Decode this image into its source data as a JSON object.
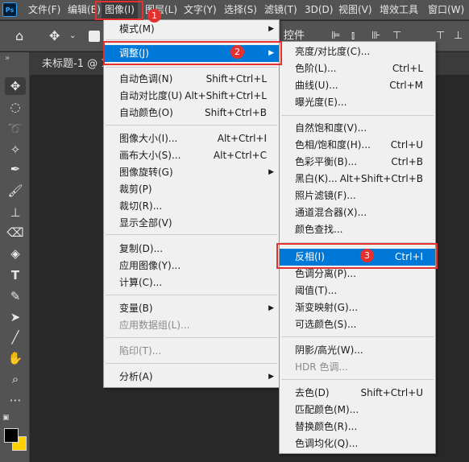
{
  "menubar": {
    "app_logo": "Ps",
    "items": [
      "文件(F)",
      "编辑(E)",
      "图像(I)",
      "图层(L)",
      "文字(Y)",
      "选择(S)",
      "滤镜(T)",
      "3D(D)",
      "视图(V)",
      "增效工具",
      "窗口(W)"
    ]
  },
  "options_bar": {
    "label": "控件"
  },
  "document": {
    "tab_title": "未标题-1 @ 1"
  },
  "image_menu": [
    {
      "label": "模式(M)",
      "shortcut": "",
      "submenu": true
    },
    {
      "label": "调整(J)",
      "shortcut": "",
      "submenu": true,
      "highlighted": true
    },
    {
      "label": "自动色调(N)",
      "shortcut": "Shift+Ctrl+L"
    },
    {
      "label": "自动对比度(U)",
      "shortcut": "Alt+Shift+Ctrl+L"
    },
    {
      "label": "自动颜色(O)",
      "shortcut": "Shift+Ctrl+B"
    },
    {
      "label": "图像大小(I)...",
      "shortcut": "Alt+Ctrl+I"
    },
    {
      "label": "画布大小(S)...",
      "shortcut": "Alt+Ctrl+C"
    },
    {
      "label": "图像旋转(G)",
      "shortcut": "",
      "submenu": true
    },
    {
      "label": "裁剪(P)",
      "shortcut": ""
    },
    {
      "label": "裁切(R)...",
      "shortcut": ""
    },
    {
      "label": "显示全部(V)",
      "shortcut": ""
    },
    {
      "label": "复制(D)...",
      "shortcut": ""
    },
    {
      "label": "应用图像(Y)...",
      "shortcut": ""
    },
    {
      "label": "计算(C)...",
      "shortcut": ""
    },
    {
      "label": "变量(B)",
      "shortcut": "",
      "submenu": true
    },
    {
      "label": "应用数据组(L)...",
      "shortcut": "",
      "disabled": true
    },
    {
      "label": "陷印(T)...",
      "shortcut": "",
      "disabled": true
    },
    {
      "label": "分析(A)",
      "shortcut": "",
      "submenu": true
    }
  ],
  "adjust_menu": [
    {
      "label": "亮度/对比度(C)...",
      "shortcut": ""
    },
    {
      "label": "色阶(L)...",
      "shortcut": "Ctrl+L"
    },
    {
      "label": "曲线(U)...",
      "shortcut": "Ctrl+M"
    },
    {
      "label": "曝光度(E)...",
      "shortcut": ""
    },
    {
      "label": "自然饱和度(V)...",
      "shortcut": ""
    },
    {
      "label": "色相/饱和度(H)...",
      "shortcut": "Ctrl+U"
    },
    {
      "label": "色彩平衡(B)...",
      "shortcut": "Ctrl+B"
    },
    {
      "label": "黑白(K)...",
      "shortcut": "Alt+Shift+Ctrl+B"
    },
    {
      "label": "照片滤镜(F)...",
      "shortcut": ""
    },
    {
      "label": "通道混合器(X)...",
      "shortcut": ""
    },
    {
      "label": "颜色查找...",
      "shortcut": ""
    },
    {
      "label": "反相(I)",
      "shortcut": "Ctrl+I",
      "highlighted": true
    },
    {
      "label": "色调分离(P)...",
      "shortcut": ""
    },
    {
      "label": "阈值(T)...",
      "shortcut": ""
    },
    {
      "label": "渐变映射(G)...",
      "shortcut": ""
    },
    {
      "label": "可选颜色(S)...",
      "shortcut": ""
    },
    {
      "label": "阴影/高光(W)...",
      "shortcut": ""
    },
    {
      "label": "HDR 色调...",
      "shortcut": "",
      "disabled": true
    },
    {
      "label": "去色(D)",
      "shortcut": "Shift+Ctrl+U"
    },
    {
      "label": "匹配颜色(M)...",
      "shortcut": ""
    },
    {
      "label": "替换颜色(R)...",
      "shortcut": ""
    },
    {
      "label": "色调均化(Q)...",
      "shortcut": ""
    }
  ],
  "annotations": [
    "1",
    "2",
    "3"
  ],
  "colors": {
    "highlight": "#0078d7",
    "annotation": "#e53030",
    "background_color": "#ffd000",
    "foreground_color": "#000000"
  }
}
